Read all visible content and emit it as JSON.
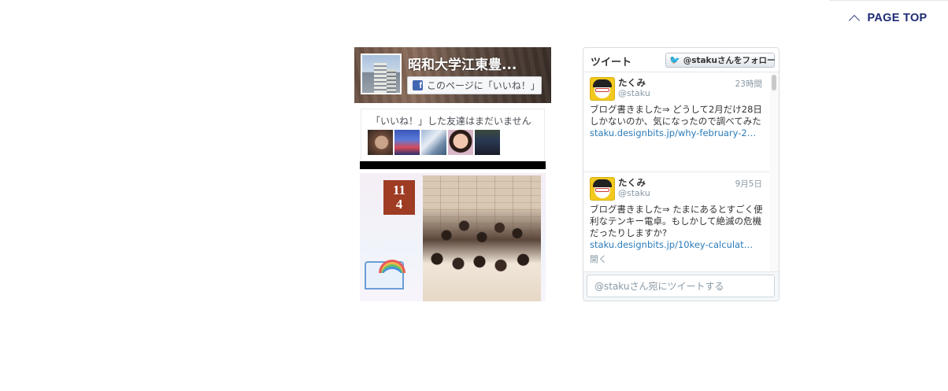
{
  "page_top": {
    "label": "PAGE TOP",
    "icon": "chevron-up-icon"
  },
  "facebook": {
    "page_name": "昭和大学江東豊...",
    "like_label": "このページに「いいね！」",
    "friends_text": "「いいね！」した友達はまだいません",
    "post_date": {
      "month": "11",
      "day": "4"
    },
    "brand_color": "#4267b2"
  },
  "twitter": {
    "title": "ツイート",
    "follow_label": "@stakuさんをフォロー",
    "tweets": [
      {
        "name": "たくみ",
        "handle": "@staku",
        "time": "23時間",
        "text": "ブログ書きました⇒ どうして2月だけ28日しかないのか、気になったので調べてみた",
        "link": "staku.designbits.jp/why-february-2…"
      },
      {
        "name": "たくみ",
        "handle": "@staku",
        "time": "9月5日",
        "text": "ブログ書きました⇒ たまにあるとすごく便利なテンキー電卓。もしかして絶滅の危機だったりしますか?",
        "link": "staku.designbits.jp/10key-calculat…",
        "expand": "開く"
      }
    ],
    "reply_placeholder": "@stakuさん宛にツイートする",
    "link_color": "#2b7bb9"
  }
}
